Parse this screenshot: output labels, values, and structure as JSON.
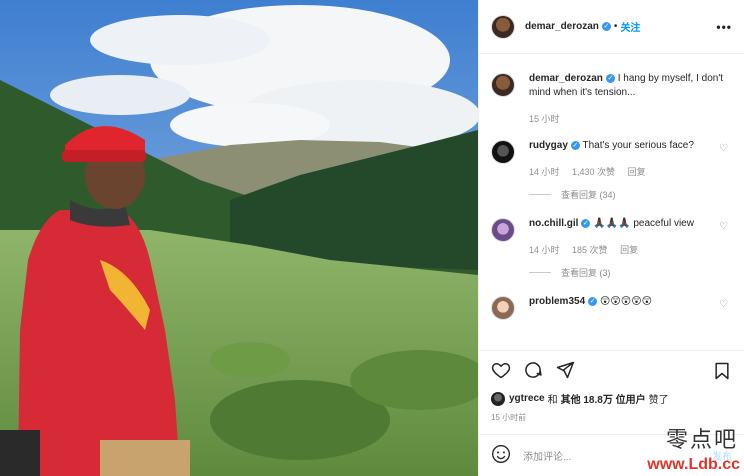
{
  "header": {
    "username": "demar_derozan",
    "follow_label": "关注",
    "more_label": "•••"
  },
  "caption": {
    "username": "demar_derozan",
    "text": "I hang by myself, I don't mind when it's tension...",
    "time": "15 小时"
  },
  "comments": [
    {
      "username": "rudygay",
      "text": "That's your serious face?",
      "time": "14 小时",
      "likes": "1,430 次赞",
      "reply_label": "回复",
      "view_replies": "查看回复 (34)"
    },
    {
      "username": "no.chill.gil",
      "text": "🙏🏿🙏🏿🙏🏿 peaceful view",
      "time": "14 小时",
      "likes": "185 次赞",
      "reply_label": "回复",
      "view_replies": "查看回复 (3)"
    },
    {
      "username": "problem354",
      "text": "😲😲😲😲😲"
    }
  ],
  "likes_line": {
    "liker": "ygtrece",
    "and": "和",
    "others": "其他 18.8万 位用户",
    "suffix": "赞了"
  },
  "post_time": "15 小时前",
  "add_comment": {
    "placeholder": "添加评论...",
    "post_label": "发布"
  },
  "watermark": {
    "cn": "零点吧",
    "url": "www.Ldb.cc"
  },
  "colors": {
    "link_blue": "#0095f6",
    "verified": "#3897f0",
    "meta_gray": "#8e8e8e"
  }
}
